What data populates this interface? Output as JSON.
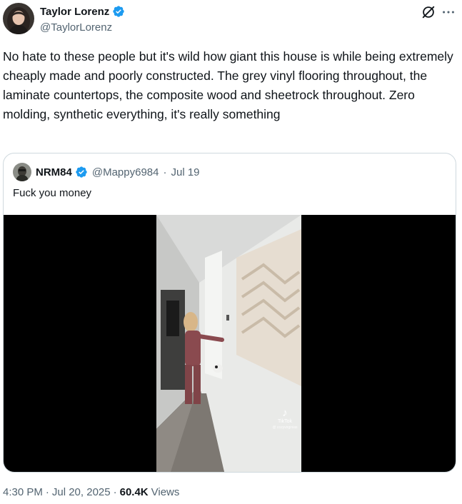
{
  "author": {
    "display_name": "Taylor Lorenz",
    "handle": "@TaylorLorenz",
    "verified": true,
    "avatar_icon": "profile-photo"
  },
  "tweet": {
    "text": "No hate to these people but it's wild how giant this house is while being extremely cheaply made and poorly constructed. The grey vinyl flooring throughout, the laminate countertops, the composite wood and sheetrock throughout. Zero molding, synthetic everything, it's really something"
  },
  "header_actions": {
    "grok_icon": "grok-icon",
    "more_icon": "more-horizontal-icon"
  },
  "quote": {
    "display_name": "NRM84",
    "handle": "@Mappy6984",
    "separator": "·",
    "date": "Jul 19",
    "verified": true,
    "text": "Fuck you money",
    "video": {
      "watermark": "TikTok",
      "watermark_handle": "@ cozyvirginias"
    }
  },
  "footer": {
    "time": "4:30 PM",
    "sep1": "·",
    "date": "Jul 20, 2025",
    "sep2": "·",
    "views_count": "60.4K",
    "views_label": "Views"
  },
  "colors": {
    "verified_blue": "#1d9bf0",
    "secondary_text": "#536471",
    "primary_text": "#0f1419",
    "border": "#cfd9de"
  }
}
